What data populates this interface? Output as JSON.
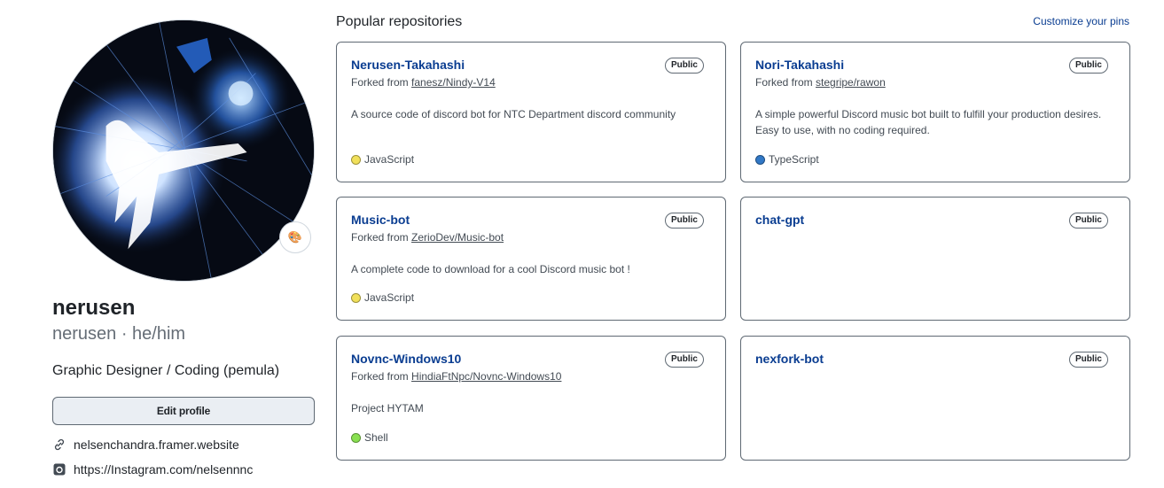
{
  "profile": {
    "name": "nerusen",
    "login_pronouns": "nerusen · he/him",
    "bio": "Graphic Designer / Coding (pemula)",
    "edit_label": "Edit profile",
    "status_emoji": "🎨",
    "website": "nelsenchandra.framer.website",
    "instagram": "https://Instagram.com/nelsennnc"
  },
  "repos": {
    "title": "Popular repositories",
    "customize_label": "Customize your pins",
    "items": [
      {
        "name": "Nerusen-Takahashi",
        "visibility": "Public",
        "forked_prefix": "Forked from",
        "forked_from": "fanesz/Nindy-V14",
        "description": "A source code of discord bot for NTC Department discord community",
        "language": "JavaScript",
        "lang_color": "#f1e05a"
      },
      {
        "name": "Nori-Takahashi",
        "visibility": "Public",
        "forked_prefix": "Forked from",
        "forked_from": "stegripe/rawon",
        "description": "A simple powerful Discord music bot built to fulfill your production desires. Easy to use, with no coding required.",
        "language": "TypeScript",
        "lang_color": "#3178c6"
      },
      {
        "name": "Music-bot",
        "visibility": "Public",
        "forked_prefix": "Forked from",
        "forked_from": "ZerioDev/Music-bot",
        "description": "A complete code to download for a cool Discord music bot !",
        "language": "JavaScript",
        "lang_color": "#f1e05a"
      },
      {
        "name": "chat-gpt",
        "visibility": "Public"
      },
      {
        "name": "Novnc-Windows10",
        "visibility": "Public",
        "forked_prefix": "Forked from",
        "forked_from": "HindiaFtNpc/Novnc-Windows10",
        "description": "Project HYTAM",
        "language": "Shell",
        "lang_color": "#89e051"
      },
      {
        "name": "nexfork-bot",
        "visibility": "Public"
      }
    ]
  }
}
